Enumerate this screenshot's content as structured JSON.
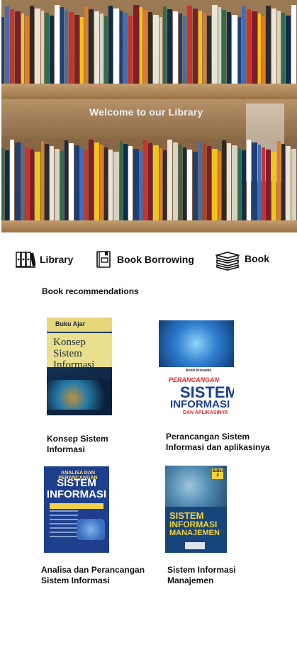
{
  "hero": {
    "title": "Welcome to our Library"
  },
  "nav": [
    {
      "label": "Library",
      "icon": "bookshelf-icon"
    },
    {
      "label": "Book Borrowing",
      "icon": "book-clipboard-icon"
    },
    {
      "label": "Book",
      "icon": "book-stack-icon"
    }
  ],
  "section_title": "Book recommendations",
  "books": [
    {
      "title": "Konsep Sistem Informasi",
      "cover_header": "Buku Ajar",
      "cover_title": "Konsep Sistem Informasi"
    },
    {
      "title": "Perancangan Sistem Informasi dan aplikasinya",
      "cover_author": "Andri Kristanto",
      "cover_line1": "PERANCANGAN",
      "cover_line2": "SISTEM",
      "cover_line3": "INFORMASI",
      "cover_line4": "DAN APLIKASINYA"
    },
    {
      "title": "Analisa dan Perancangan Sistem Informasi",
      "cover_line1": "ANALISA DAN PERANCANGAN",
      "cover_line2": "SISTEM",
      "cover_line3": "INFORMASI"
    },
    {
      "title": "Sistem Informasi Manajemen",
      "cover_badge": "Edisi 3",
      "cover_line1": "SISTEM",
      "cover_line2": "INFORMASI",
      "cover_line3": "MANAJEMEN"
    }
  ]
}
